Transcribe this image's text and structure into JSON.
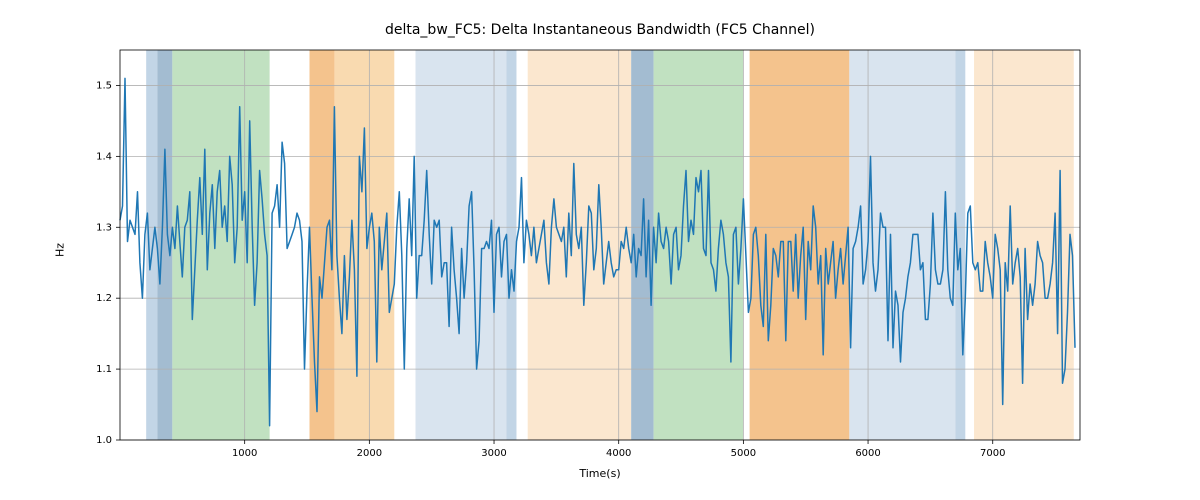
{
  "chart_data": {
    "type": "line",
    "title": "delta_bw_FC5: Delta Instantaneous Bandwidth (FC5 Channel)",
    "xlabel": "Time(s)",
    "ylabel": "Hz",
    "xlim": [
      0,
      7700
    ],
    "ylim": [
      1.0,
      1.55
    ],
    "xticks": [
      1000,
      2000,
      3000,
      4000,
      5000,
      6000,
      7000
    ],
    "yticks": [
      1.0,
      1.1,
      1.2,
      1.3,
      1.4,
      1.5
    ],
    "grid": true,
    "bands": [
      {
        "x0": 210,
        "x1": 300,
        "color": "#c2d5e6"
      },
      {
        "x0": 300,
        "x1": 420,
        "color": "#a3bcd1"
      },
      {
        "x0": 420,
        "x1": 1200,
        "color": "#c1e1c1"
      },
      {
        "x0": 1520,
        "x1": 1720,
        "color": "#f4c38d"
      },
      {
        "x0": 1720,
        "x1": 2200,
        "color": "#f9dab0"
      },
      {
        "x0": 2370,
        "x1": 3100,
        "color": "#d9e4ef"
      },
      {
        "x0": 3100,
        "x1": 3180,
        "color": "#c2d5e6"
      },
      {
        "x0": 3270,
        "x1": 4100,
        "color": "#fbe7cf"
      },
      {
        "x0": 4100,
        "x1": 4280,
        "color": "#a3bcd1"
      },
      {
        "x0": 4280,
        "x1": 5000,
        "color": "#c1e1c1"
      },
      {
        "x0": 5050,
        "x1": 5850,
        "color": "#f4c38d"
      },
      {
        "x0": 5850,
        "x1": 6700,
        "color": "#d9e4ef"
      },
      {
        "x0": 6700,
        "x1": 6780,
        "color": "#c2d5e6"
      },
      {
        "x0": 6850,
        "x1": 7650,
        "color": "#fbe7cf"
      }
    ],
    "series": [
      {
        "name": "delta_bw_FC5",
        "color": "#1f77b4",
        "x_start": 0,
        "x_step": 20,
        "values": [
          1.31,
          1.33,
          1.51,
          1.28,
          1.31,
          1.3,
          1.29,
          1.35,
          1.25,
          1.2,
          1.29,
          1.32,
          1.24,
          1.27,
          1.3,
          1.27,
          1.22,
          1.3,
          1.41,
          1.29,
          1.26,
          1.3,
          1.27,
          1.33,
          1.28,
          1.23,
          1.3,
          1.31,
          1.35,
          1.17,
          1.24,
          1.31,
          1.37,
          1.29,
          1.41,
          1.24,
          1.32,
          1.36,
          1.27,
          1.35,
          1.38,
          1.3,
          1.33,
          1.28,
          1.4,
          1.36,
          1.25,
          1.3,
          1.47,
          1.31,
          1.35,
          1.25,
          1.45,
          1.3,
          1.19,
          1.25,
          1.38,
          1.34,
          1.29,
          1.26,
          1.02,
          1.32,
          1.33,
          1.36,
          1.3,
          1.42,
          1.39,
          1.27,
          1.28,
          1.29,
          1.3,
          1.32,
          1.31,
          1.28,
          1.1,
          1.21,
          1.3,
          1.2,
          1.11,
          1.04,
          1.23,
          1.2,
          1.25,
          1.3,
          1.31,
          1.24,
          1.47,
          1.26,
          1.2,
          1.15,
          1.26,
          1.17,
          1.23,
          1.31,
          1.24,
          1.09,
          1.4,
          1.35,
          1.44,
          1.27,
          1.3,
          1.32,
          1.28,
          1.11,
          1.3,
          1.24,
          1.28,
          1.32,
          1.18,
          1.2,
          1.22,
          1.3,
          1.35,
          1.26,
          1.1,
          1.27,
          1.34,
          1.26,
          1.4,
          1.2,
          1.26,
          1.26,
          1.31,
          1.38,
          1.29,
          1.22,
          1.31,
          1.3,
          1.31,
          1.23,
          1.25,
          1.25,
          1.16,
          1.3,
          1.24,
          1.2,
          1.15,
          1.27,
          1.2,
          1.25,
          1.33,
          1.35,
          1.24,
          1.1,
          1.14,
          1.27,
          1.27,
          1.28,
          1.27,
          1.31,
          1.18,
          1.29,
          1.3,
          1.23,
          1.28,
          1.29,
          1.2,
          1.24,
          1.21,
          1.28,
          1.3,
          1.37,
          1.25,
          1.31,
          1.29,
          1.26,
          1.3,
          1.25,
          1.27,
          1.29,
          1.31,
          1.25,
          1.22,
          1.3,
          1.34,
          1.3,
          1.29,
          1.28,
          1.3,
          1.23,
          1.32,
          1.26,
          1.39,
          1.29,
          1.27,
          1.3,
          1.19,
          1.25,
          1.33,
          1.32,
          1.24,
          1.27,
          1.36,
          1.3,
          1.22,
          1.25,
          1.28,
          1.25,
          1.23,
          1.24,
          1.24,
          1.28,
          1.27,
          1.3,
          1.27,
          1.25,
          1.29,
          1.23,
          1.27,
          1.26,
          1.34,
          1.23,
          1.31,
          1.19,
          1.3,
          1.25,
          1.32,
          1.28,
          1.27,
          1.3,
          1.28,
          1.22,
          1.29,
          1.3,
          1.24,
          1.26,
          1.33,
          1.38,
          1.28,
          1.31,
          1.29,
          1.37,
          1.35,
          1.38,
          1.27,
          1.26,
          1.38,
          1.25,
          1.24,
          1.21,
          1.27,
          1.31,
          1.29,
          1.25,
          1.23,
          1.11,
          1.29,
          1.3,
          1.22,
          1.27,
          1.34,
          1.26,
          1.18,
          1.2,
          1.29,
          1.3,
          1.26,
          1.19,
          1.16,
          1.29,
          1.14,
          1.19,
          1.27,
          1.26,
          1.23,
          1.28,
          1.28,
          1.14,
          1.28,
          1.28,
          1.21,
          1.29,
          1.2,
          1.26,
          1.3,
          1.17,
          1.28,
          1.24,
          1.33,
          1.3,
          1.22,
          1.26,
          1.12,
          1.27,
          1.22,
          1.25,
          1.28,
          1.2,
          1.24,
          1.27,
          1.22,
          1.26,
          1.3,
          1.13,
          1.27,
          1.28,
          1.3,
          1.33,
          1.22,
          1.24,
          1.28,
          1.4,
          1.25,
          1.21,
          1.24,
          1.32,
          1.3,
          1.3,
          1.14,
          1.29,
          1.13,
          1.21,
          1.19,
          1.11,
          1.18,
          1.2,
          1.23,
          1.25,
          1.29,
          1.29,
          1.29,
          1.24,
          1.25,
          1.17,
          1.17,
          1.22,
          1.32,
          1.24,
          1.22,
          1.22,
          1.24,
          1.35,
          1.24,
          1.2,
          1.19,
          1.32,
          1.24,
          1.27,
          1.12,
          1.2,
          1.32,
          1.33,
          1.25,
          1.24,
          1.25,
          1.21,
          1.21,
          1.28,
          1.25,
          1.23,
          1.2,
          1.29,
          1.27,
          1.24,
          1.05,
          1.25,
          1.21,
          1.33,
          1.22,
          1.25,
          1.27,
          1.23,
          1.08,
          1.27,
          1.17,
          1.22,
          1.19,
          1.22,
          1.28,
          1.26,
          1.25,
          1.2,
          1.2,
          1.22,
          1.25,
          1.32,
          1.15,
          1.38,
          1.08,
          1.1,
          1.18,
          1.29,
          1.26,
          1.13
        ]
      }
    ]
  }
}
